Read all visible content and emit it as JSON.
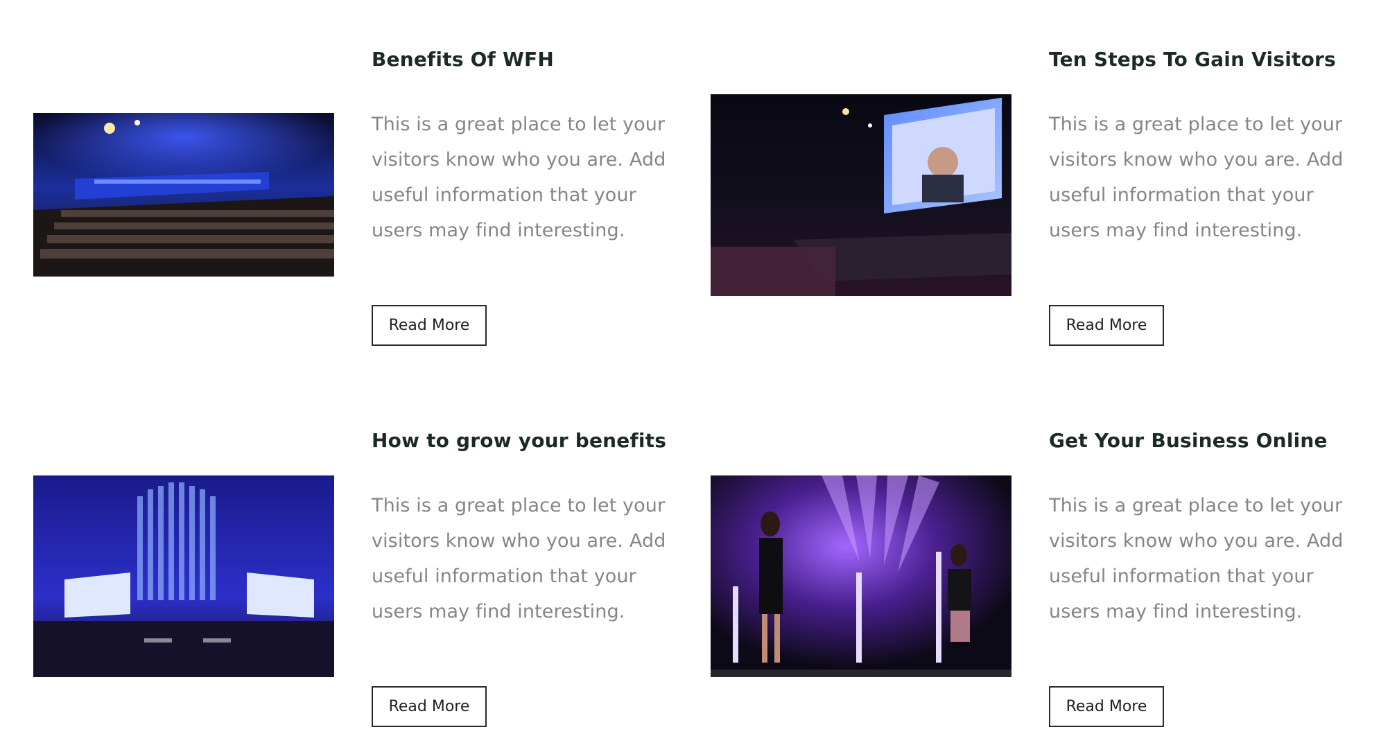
{
  "cards": [
    {
      "title": "Benefits Of WFH",
      "body": "This is a great place to let your visitors know who you are. Add useful information that your users may find interesting.",
      "button_label": "Read More",
      "image": "conference-hall-photo"
    },
    {
      "title": "Ten Steps To Gain Visitors",
      "body": "This is a great place to let your visitors know who you are. Add useful information that your users may find interesting.",
      "button_label": "Read More",
      "image": "speaker-on-screen-photo"
    },
    {
      "title": "How to grow your benefits",
      "body": "This is a great place to let your visitors know who you are. Add useful information that your users may find interesting.",
      "button_label": "Read More",
      "image": "organ-hall-photo"
    },
    {
      "title": "Get Your Business Online",
      "body": "This is a great place to let your visitors know who you are. Add useful information that your users may find interesting.",
      "button_label": "Read More",
      "image": "two-presenters-stage-photo"
    }
  ],
  "colors": {
    "heading": "#1c2a26",
    "body_text": "#858585",
    "button_border": "#2b2b2b"
  }
}
